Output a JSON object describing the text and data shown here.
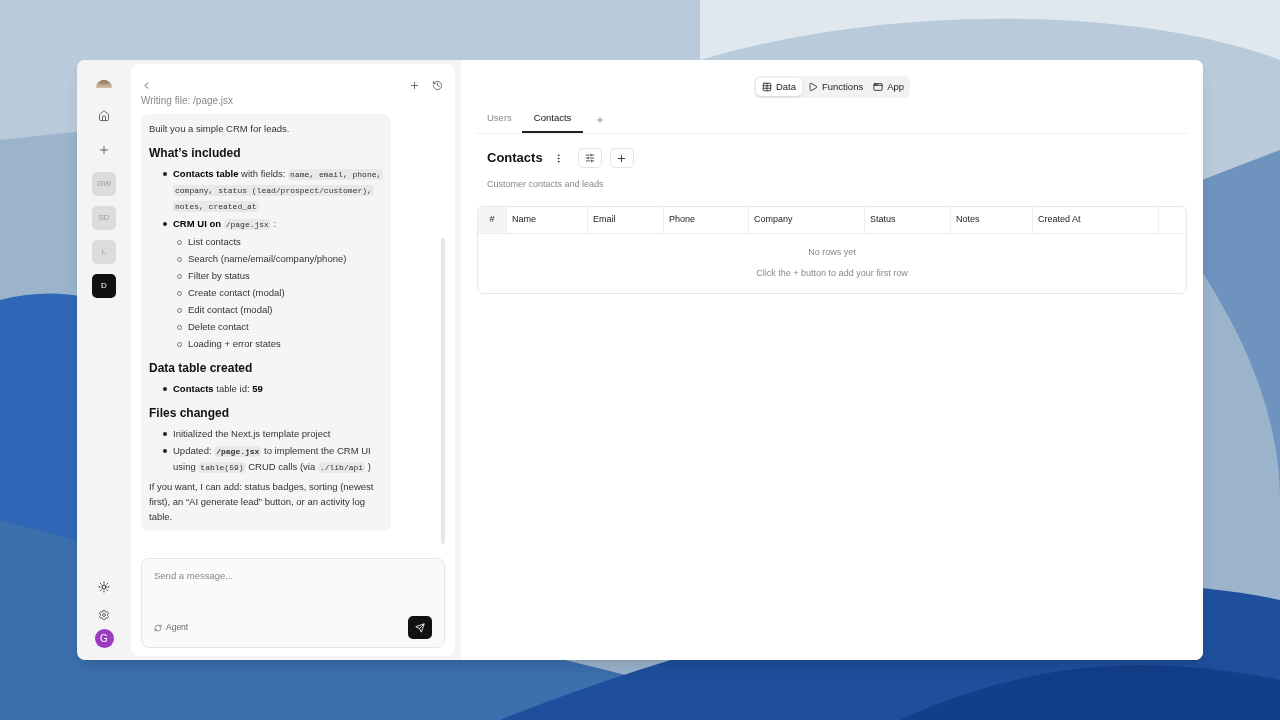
{
  "rail": {
    "workspaces": [
      {
        "label": "GW",
        "selected": false
      },
      {
        "label": "SD",
        "selected": false
      },
      {
        "label": "L",
        "selected": false
      },
      {
        "label": "D",
        "selected": true
      }
    ],
    "user_initial": "G"
  },
  "chat": {
    "status": "Writing file: /page.jsx",
    "message": [
      {
        "kind": "paragraph",
        "text": "Built you a simple CRM for leads."
      },
      {
        "kind": "heading",
        "text": "What’s included"
      },
      {
        "kind": "list",
        "items": [
          {
            "segments": [
              {
                "kind": "bold",
                "text": "Contacts table"
              },
              " with fields: ",
              {
                "kind": "code",
                "text": "name, email, phone, company, status (lead/prospect/customer), notes, created_at"
              }
            ]
          },
          {
            "segments": [
              {
                "kind": "bold",
                "text": "CRM UI on "
              },
              {
                "kind": "code",
                "text": "/page.jsx"
              },
              " :"
            ],
            "children": [
              {
                "text": "List contacts"
              },
              {
                "text": "Search (name/email/company/phone)"
              },
              {
                "text": "Filter by status"
              },
              {
                "text": "Create contact (modal)"
              },
              {
                "text": "Edit contact (modal)"
              },
              {
                "text": "Delete contact"
              },
              {
                "text": "Loading + error states"
              }
            ]
          }
        ]
      },
      {
        "kind": "heading",
        "text": "Data table created"
      },
      {
        "kind": "list",
        "items": [
          {
            "segments": [
              {
                "kind": "bold",
                "text": "Contacts"
              },
              " table id: ",
              {
                "kind": "bold",
                "text": "59"
              }
            ]
          }
        ]
      },
      {
        "kind": "heading",
        "text": "Files changed"
      },
      {
        "kind": "list",
        "items": [
          {
            "text": "Initialized the Next.js template project"
          },
          {
            "segments": [
              "Updated: ",
              {
                "kind": "codebold",
                "text": "/page.jsx"
              },
              " to implement the CRM UI using ",
              {
                "kind": "code",
                "text": "table(59)"
              },
              " CRUD calls (via ",
              {
                "kind": "code",
                "text": "./lib/api"
              },
              " )"
            ]
          }
        ]
      },
      {
        "kind": "paragraph",
        "text": "If you want, I can add: status badges, sorting (newest first), an “AI generate lead” button, or an activity log table."
      }
    ],
    "composer": {
      "placeholder": "Send a message...",
      "mode": "Agent"
    }
  },
  "views": [
    {
      "label": "Data",
      "selected": true
    },
    {
      "label": "Functions",
      "selected": false
    },
    {
      "label": "App",
      "selected": false
    }
  ],
  "tabs": [
    {
      "label": "Users",
      "selected": false
    },
    {
      "label": "Contacts",
      "selected": true
    }
  ],
  "table": {
    "title": "Contacts",
    "subtitle": "Customer contacts and leads",
    "columns": [
      "#",
      "Name",
      "Email",
      "Phone",
      "Company",
      "Status",
      "Notes",
      "Created At"
    ],
    "empty_title": "No rows yet",
    "empty_hint": "Click the + button to add your first row"
  }
}
